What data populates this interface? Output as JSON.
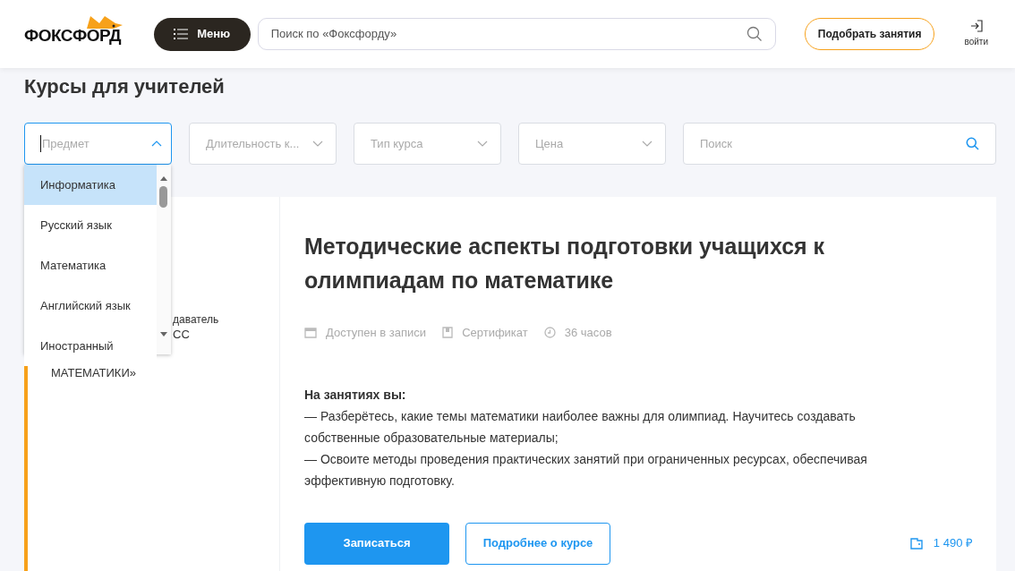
{
  "header": {
    "logo": "ФОКСФОРД",
    "menu_button": "Меню",
    "search": {
      "placeholder": "Поиск по «Фоксфорду»"
    },
    "pick_button": "Подобрать занятия",
    "login": "войти"
  },
  "page_title": "Курсы для учителей",
  "filters": [
    {
      "placeholder": "Предмет",
      "expanded": true
    },
    {
      "placeholder": "Длительность к...",
      "expanded": false
    },
    {
      "placeholder": "Тип курса",
      "expanded": false
    },
    {
      "placeholder": "Цена",
      "expanded": false
    }
  ],
  "search": {
    "placeholder": "Поиск"
  },
  "dropdown": {
    "items": [
      {
        "label": "Информатика",
        "selected": true
      },
      {
        "label": "Русский язык",
        "selected": false
      },
      {
        "label": "Математика",
        "selected": false
      },
      {
        "label": "Английский язык",
        "selected": false
      },
      {
        "label": "Иностранный",
        "selected": false
      }
    ]
  },
  "course": {
    "side_lines": [
      "даватель",
      "СС",
      "МАТЕМАТИКИ»"
    ],
    "title": "Методические аспекты подготовки учащихся к олимпиадам по математике",
    "features": [
      {
        "kind": "calendar",
        "text": "Доступен в записи"
      },
      {
        "kind": "certificate",
        "text": "Сертификат"
      },
      {
        "kind": "clock",
        "text": "36 часов"
      }
    ],
    "description": "**На занятиях вы:**",
    "points": [
      "— Разберётесь, какие темы математики наиболее важны для олимпиад. Научитесь создавать собственные образовательные материалы;",
      "— Освоите методы проведения практических занятий при ограниченных ресурсах, обеспечивая эффективную подготовку."
    ],
    "enroll_button": "Записаться",
    "more_button": "Подробнее о курсе",
    "price": "1 490 ₽"
  }
}
